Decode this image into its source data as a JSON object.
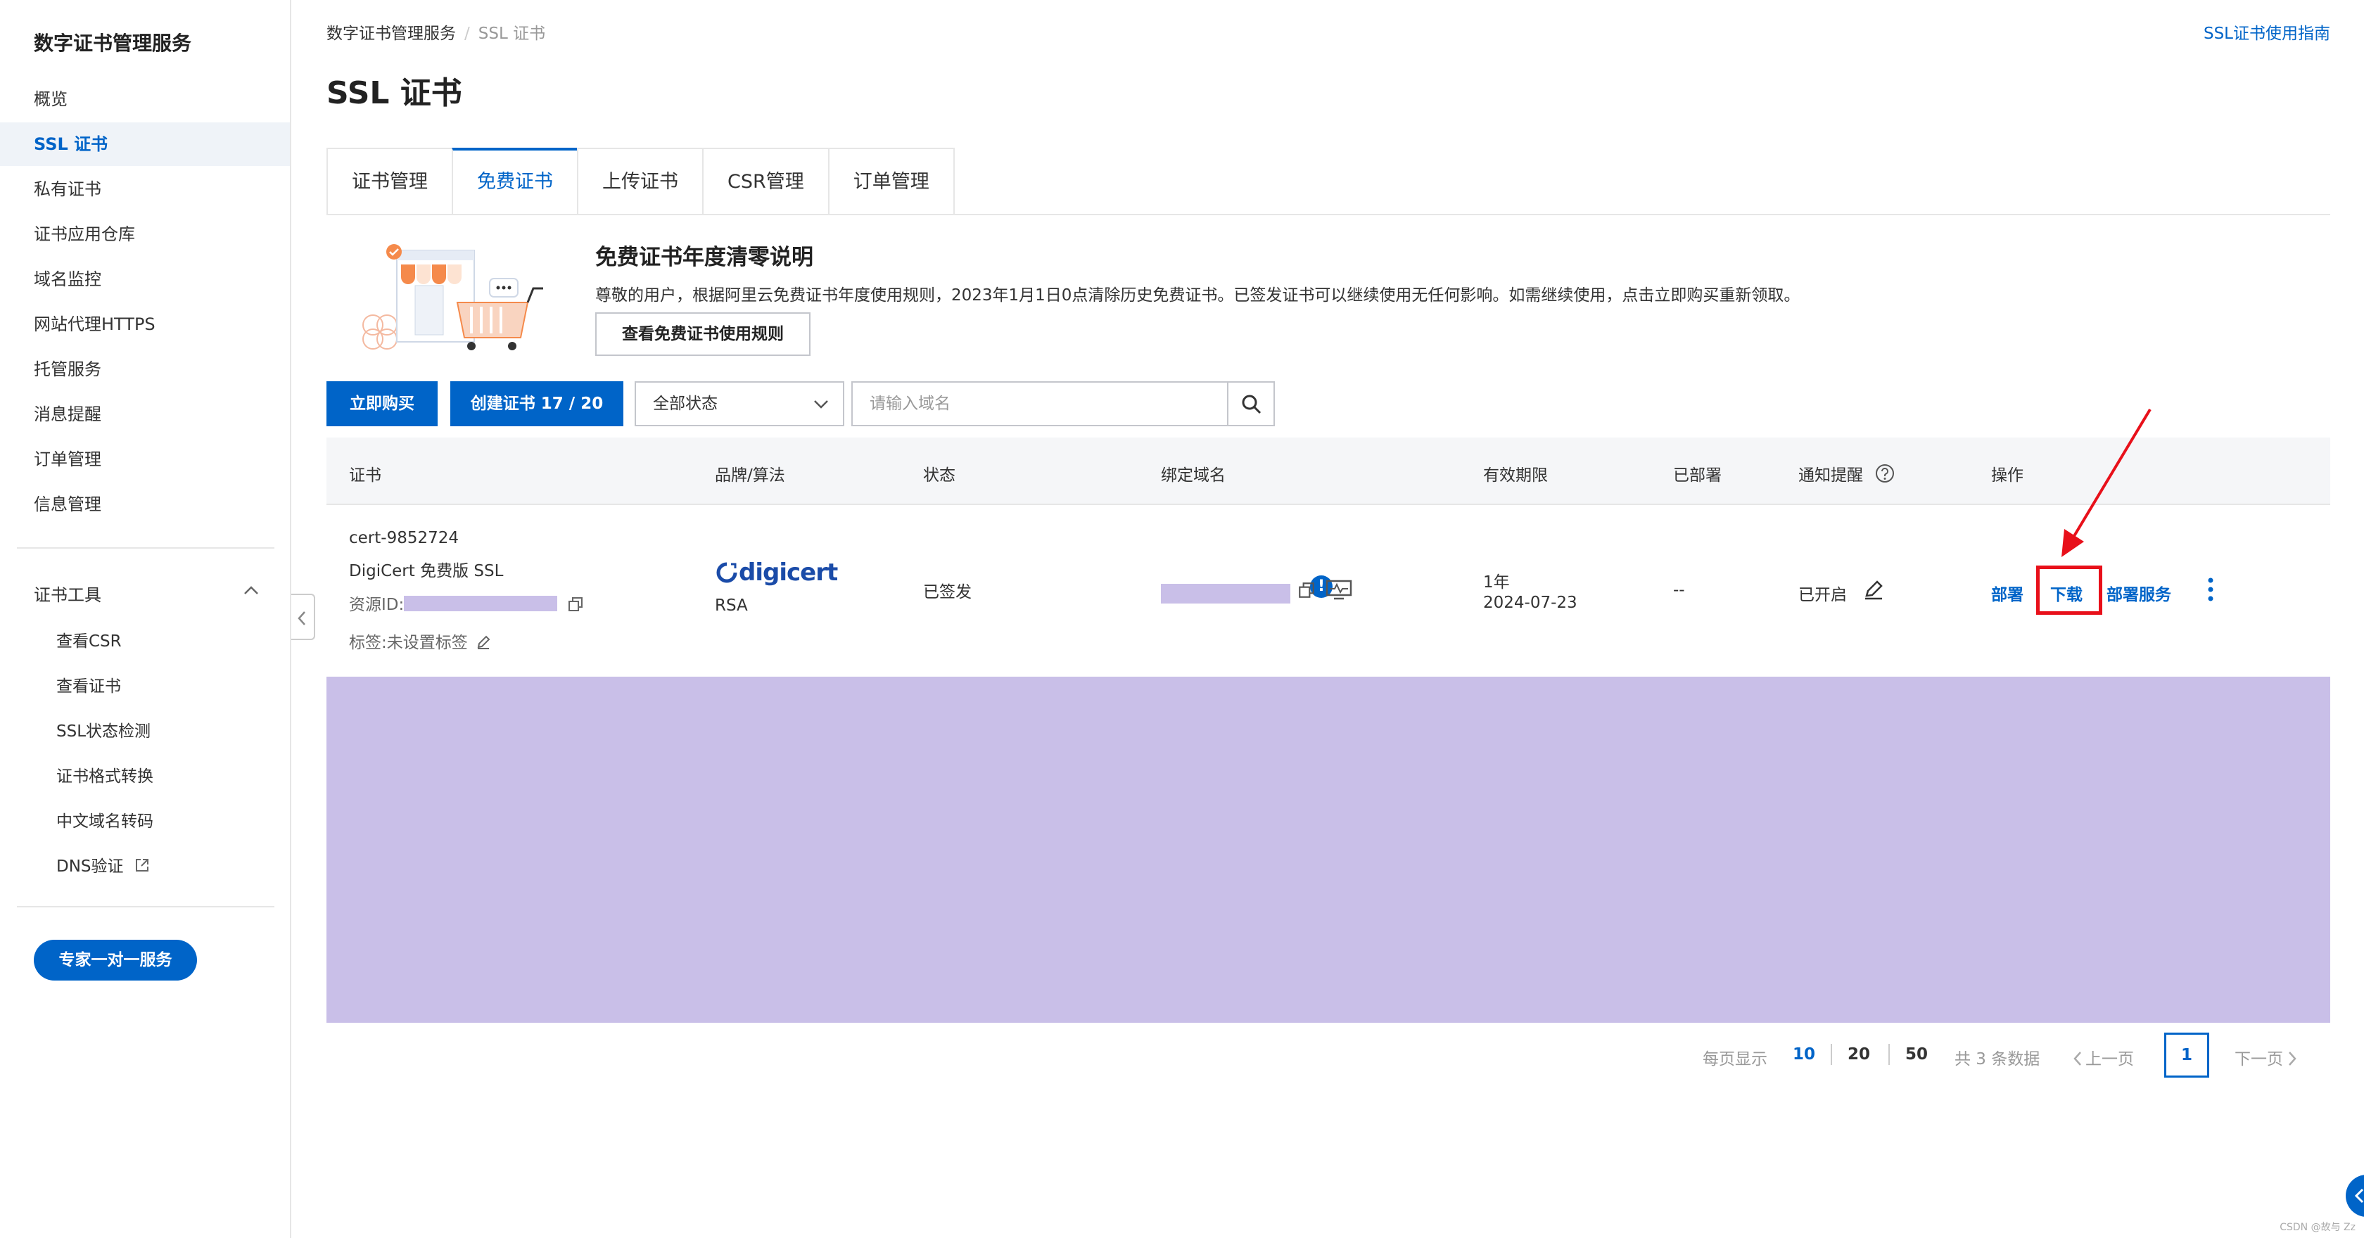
{
  "sidebar": {
    "title": "数字证书管理服务",
    "items": [
      {
        "label": "概览"
      },
      {
        "label": "SSL 证书",
        "active": true
      },
      {
        "label": "私有证书"
      },
      {
        "label": "证书应用仓库"
      },
      {
        "label": "域名监控"
      },
      {
        "label": "网站代理HTTPS"
      },
      {
        "label": "托管服务"
      },
      {
        "label": "消息提醒"
      },
      {
        "label": "订单管理"
      },
      {
        "label": "信息管理"
      }
    ],
    "tools_group": "证书工具",
    "tools": [
      {
        "label": "查看CSR"
      },
      {
        "label": "查看证书"
      },
      {
        "label": "SSL状态检测"
      },
      {
        "label": "证书格式转换"
      },
      {
        "label": "中文域名转码"
      },
      {
        "label": "DNS验证"
      }
    ],
    "expert_button": "专家一对一服务"
  },
  "breadcrumb": {
    "root": "数字证书管理服务",
    "separator": "/",
    "current": "SSL 证书"
  },
  "guide_link": "SSL证书使用指南",
  "page_title": "SSL 证书",
  "tabs": [
    {
      "label": "证书管理"
    },
    {
      "label": "免费证书",
      "active": true
    },
    {
      "label": "上传证书"
    },
    {
      "label": "CSR管理"
    },
    {
      "label": "订单管理"
    }
  ],
  "banner": {
    "title": "免费证书年度清零说明",
    "description": "尊敬的用户，根据阿里云免费证书年度使用规则，2023年1月1日0点清除历史免费证书。已签发证书可以继续使用无任何影响。如需继续使用，点击立即购买重新领取。",
    "button": "查看免费证书使用规则"
  },
  "toolbar": {
    "buy_button": "立即购买",
    "create_button": "创建证书 17 / 20",
    "status_select": "全部状态",
    "search_placeholder": "请输入域名"
  },
  "table": {
    "headers": [
      "证书",
      "品牌/算法",
      "状态",
      "绑定域名",
      "有效期限",
      "已部署",
      "通知提醒",
      "操作"
    ],
    "rows": [
      {
        "name": "cert-9852724",
        "brand_name": "DigiCert 免费版 SSL",
        "resource_id_label": "资源ID:",
        "tag_label": "标签:未设置标签",
        "brand_logo": "digicert",
        "algorithm": "RSA",
        "status": "已签发",
        "status_badge": "!",
        "validity_period": "1年",
        "expiry_date": "2024-07-23",
        "deployed": "--",
        "notify": "已开启",
        "actions": {
          "deploy": "部署",
          "download": "下载",
          "deploy_service": "部署服务"
        }
      }
    ]
  },
  "pagination": {
    "page_size_label": "每页显示",
    "page_sizes": [
      "10",
      "20",
      "50"
    ],
    "active_size": "10",
    "total": "共 3 条数据",
    "prev": "上一页",
    "current_page": "1",
    "next": "下一页"
  },
  "watermark": "CSDN @故与 Zz",
  "colors": {
    "accent": "#0064c8",
    "highlight": "#e8101a",
    "mask": "#c9bfe8"
  }
}
